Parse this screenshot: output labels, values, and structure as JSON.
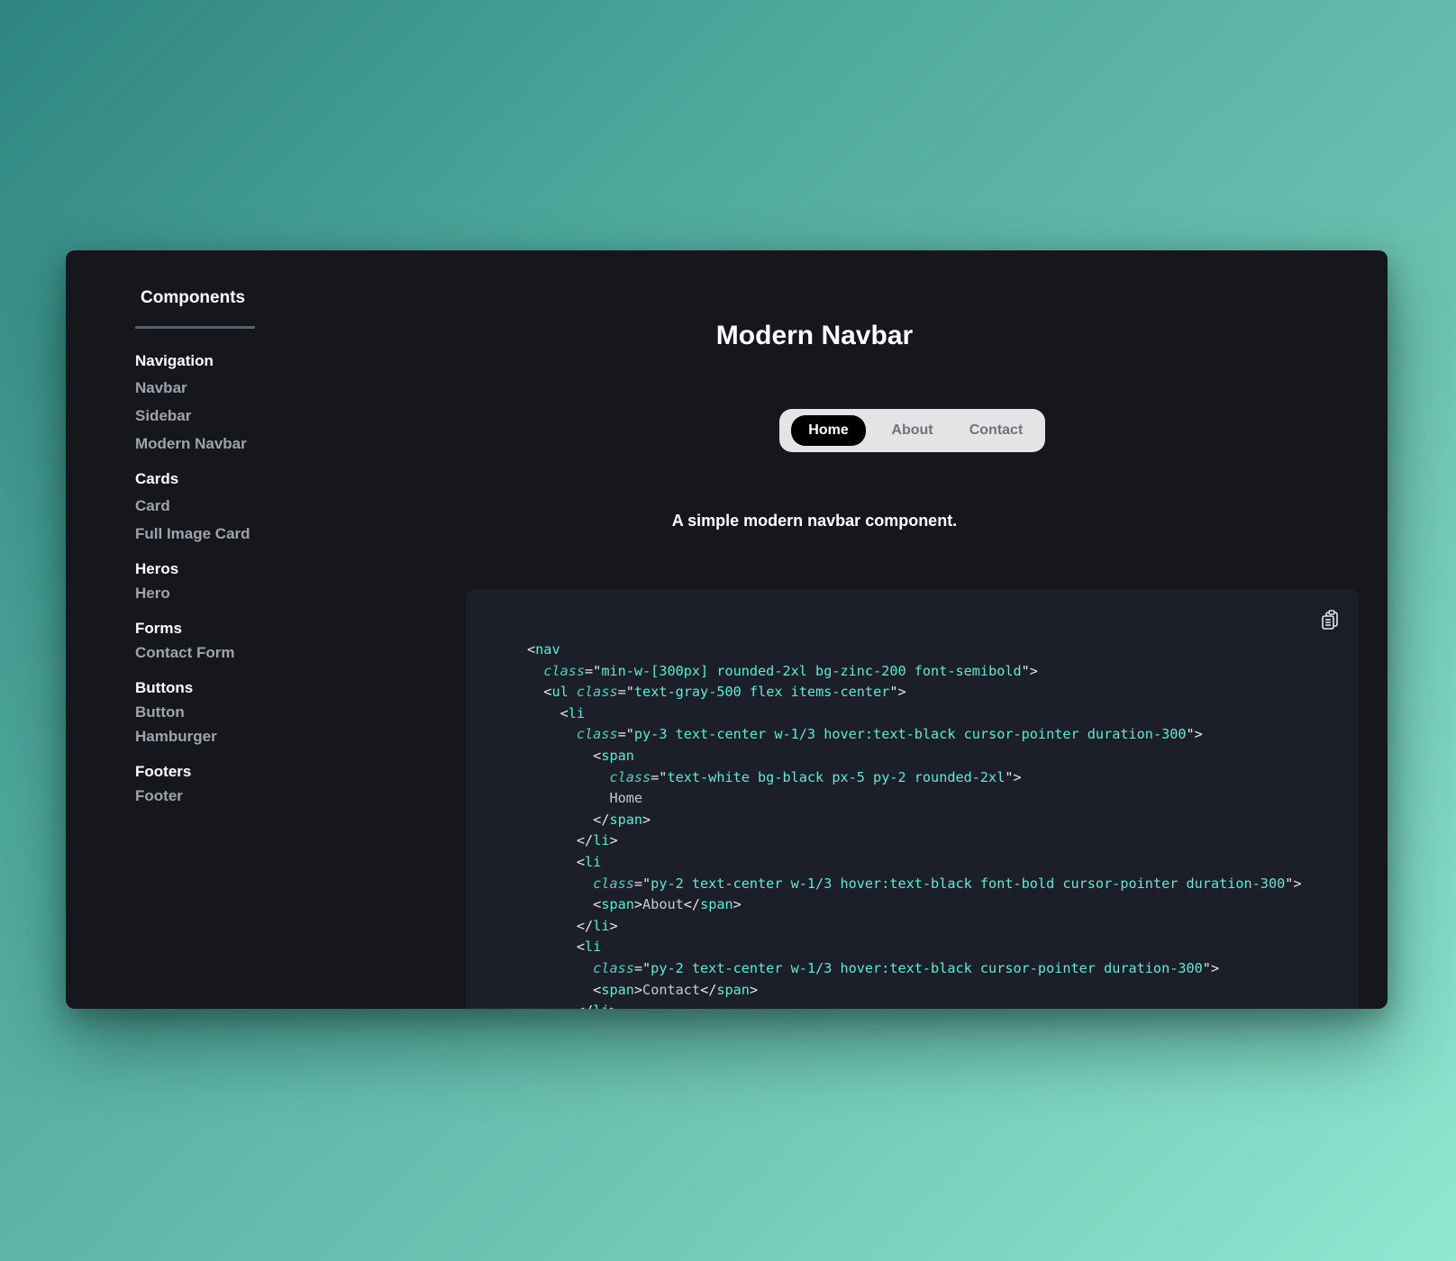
{
  "sidebar": {
    "title": "Components",
    "groups": [
      {
        "title": "Navigation",
        "items": [
          "Navbar",
          "Sidebar",
          "Modern Navbar"
        ]
      },
      {
        "title": "Cards",
        "items": [
          "Card",
          "Full Image Card"
        ]
      },
      {
        "title": "Heros",
        "items": [
          "Hero"
        ]
      },
      {
        "title": "Forms",
        "items": [
          "Contact Form"
        ]
      },
      {
        "title": "Buttons",
        "items": [
          "Button",
          "Hamburger"
        ]
      },
      {
        "title": "Footers",
        "items": [
          "Footer"
        ]
      }
    ]
  },
  "main": {
    "title": "Modern Navbar",
    "description": "A simple modern navbar component.",
    "demo_nav": {
      "items": [
        "Home",
        "About",
        "Contact"
      ],
      "active": "Home"
    },
    "code": {
      "copy_icon": "clipboard-icon",
      "lines": [
        {
          "indent": 0,
          "tokens": [
            [
              "punc",
              "<"
            ],
            [
              "tag",
              "nav"
            ]
          ]
        },
        {
          "indent": 1,
          "tokens": [
            [
              "attr",
              "class"
            ],
            [
              "punc",
              "=\""
            ],
            [
              "str",
              "min-w-[300px] rounded-2xl bg-zinc-200 font-semibold"
            ],
            [
              "punc",
              "\">"
            ]
          ]
        },
        {
          "indent": 1,
          "tokens": [
            [
              "punc",
              "<"
            ],
            [
              "tag",
              "ul "
            ],
            [
              "attr",
              "class"
            ],
            [
              "punc",
              "=\""
            ],
            [
              "str",
              "text-gray-500 flex items-center"
            ],
            [
              "punc",
              "\">"
            ]
          ]
        },
        {
          "indent": 2,
          "tokens": [
            [
              "punc",
              "<"
            ],
            [
              "tag",
              "li"
            ]
          ]
        },
        {
          "indent": 3,
          "tokens": [
            [
              "attr",
              "class"
            ],
            [
              "punc",
              "=\""
            ],
            [
              "str",
              "py-3 text-center w-1/3 hover:text-black cursor-pointer duration-300"
            ],
            [
              "punc",
              "\">"
            ]
          ]
        },
        {
          "indent": 4,
          "tokens": [
            [
              "punc",
              "<"
            ],
            [
              "tag",
              "span"
            ]
          ]
        },
        {
          "indent": 5,
          "tokens": [
            [
              "attr",
              "class"
            ],
            [
              "punc",
              "=\""
            ],
            [
              "str",
              "text-white bg-black px-5 py-2 rounded-2xl"
            ],
            [
              "punc",
              "\">"
            ]
          ]
        },
        {
          "indent": 5,
          "tokens": [
            [
              "text",
              "Home"
            ]
          ]
        },
        {
          "indent": 4,
          "tokens": [
            [
              "punc",
              "</"
            ],
            [
              "tag",
              "span"
            ],
            [
              "punc",
              ">"
            ]
          ]
        },
        {
          "indent": 3,
          "tokens": [
            [
              "punc",
              "</"
            ],
            [
              "tag",
              "li"
            ],
            [
              "punc",
              ">"
            ]
          ]
        },
        {
          "indent": 3,
          "tokens": [
            [
              "punc",
              "<"
            ],
            [
              "tag",
              "li"
            ]
          ]
        },
        {
          "indent": 4,
          "tokens": [
            [
              "attr",
              "class"
            ],
            [
              "punc",
              "=\""
            ],
            [
              "str",
              "py-2 text-center w-1/3 hover:text-black font-bold cursor-pointer duration-300"
            ],
            [
              "punc",
              "\">"
            ]
          ]
        },
        {
          "indent": 4,
          "tokens": [
            [
              "punc",
              "<"
            ],
            [
              "tag",
              "span"
            ],
            [
              "punc",
              ">"
            ],
            [
              "text",
              "About"
            ],
            [
              "punc",
              "</"
            ],
            [
              "tag",
              "span"
            ],
            [
              "punc",
              ">"
            ]
          ]
        },
        {
          "indent": 3,
          "tokens": [
            [
              "punc",
              "</"
            ],
            [
              "tag",
              "li"
            ],
            [
              "punc",
              ">"
            ]
          ]
        },
        {
          "indent": 3,
          "tokens": [
            [
              "punc",
              "<"
            ],
            [
              "tag",
              "li"
            ]
          ]
        },
        {
          "indent": 4,
          "tokens": [
            [
              "attr",
              "class"
            ],
            [
              "punc",
              "=\""
            ],
            [
              "str",
              "py-2 text-center w-1/3 hover:text-black cursor-pointer duration-300"
            ],
            [
              "punc",
              "\">"
            ]
          ]
        },
        {
          "indent": 4,
          "tokens": [
            [
              "punc",
              "<"
            ],
            [
              "tag",
              "span"
            ],
            [
              "punc",
              ">"
            ],
            [
              "text",
              "Contact"
            ],
            [
              "punc",
              "</"
            ],
            [
              "tag",
              "span"
            ],
            [
              "punc",
              ">"
            ]
          ]
        },
        {
          "indent": 3,
          "tokens": [
            [
              "punc",
              "</"
            ],
            [
              "tag",
              "li"
            ],
            [
              "punc",
              ">"
            ]
          ]
        }
      ]
    }
  },
  "colors": {
    "window_bg": "#16171d",
    "code_bg": "#1c1f29",
    "code_accent": "#5eead4",
    "demo_nav_bg": "#e4e4e7",
    "sidebar_item": "#9ea3ad"
  }
}
